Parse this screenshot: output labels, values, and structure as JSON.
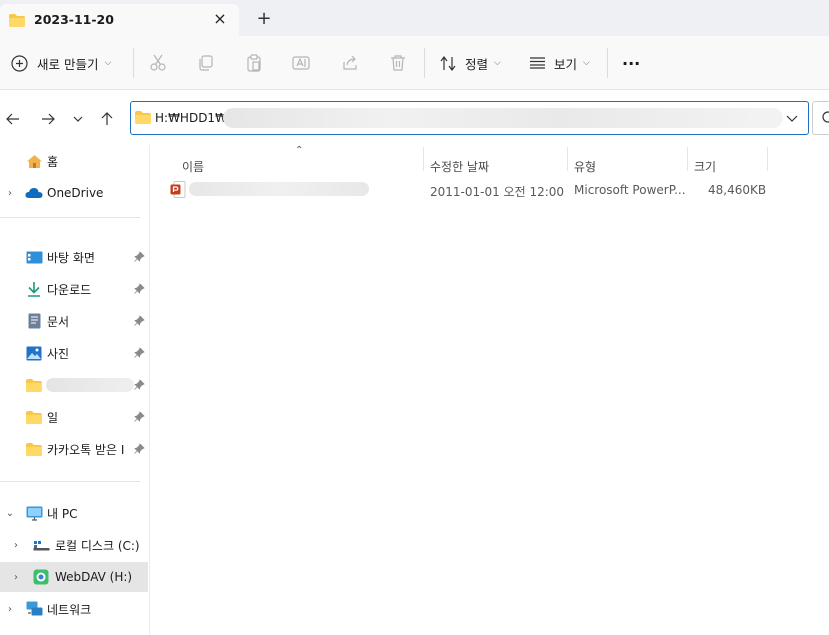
{
  "tab": {
    "title": "2023-11-20",
    "close": "×",
    "new_tab": "+"
  },
  "toolbar": {
    "new_label": "새로 만들기",
    "sort_label": "정렬",
    "view_label": "보기",
    "more": "···"
  },
  "address": {
    "path": "H:₩HDD1₩"
  },
  "sidebar": {
    "home": "홈",
    "onedrive": "OneDrive",
    "desktop": "바탕 화면",
    "downloads": "다운로드",
    "documents": "문서",
    "pictures": "사진",
    "work": "일",
    "kakao": "카카오톡 받은 I",
    "this_pc": "내 PC",
    "local_disk": "로컬 디스크 (C:)",
    "webdav": "WebDAV (H:)",
    "network": "네트워크"
  },
  "columns": {
    "name": "이름",
    "modified": "수정한 날짜",
    "type": "유형",
    "size": "크기"
  },
  "files": [
    {
      "modified": "2011-01-01 오전 12:00",
      "type": "Microsoft PowerP...",
      "size": "48,460KB"
    }
  ],
  "colors": {
    "accent": "#1f6fc1",
    "folder": "#f7c84a",
    "ppt": "#c43e1c"
  }
}
